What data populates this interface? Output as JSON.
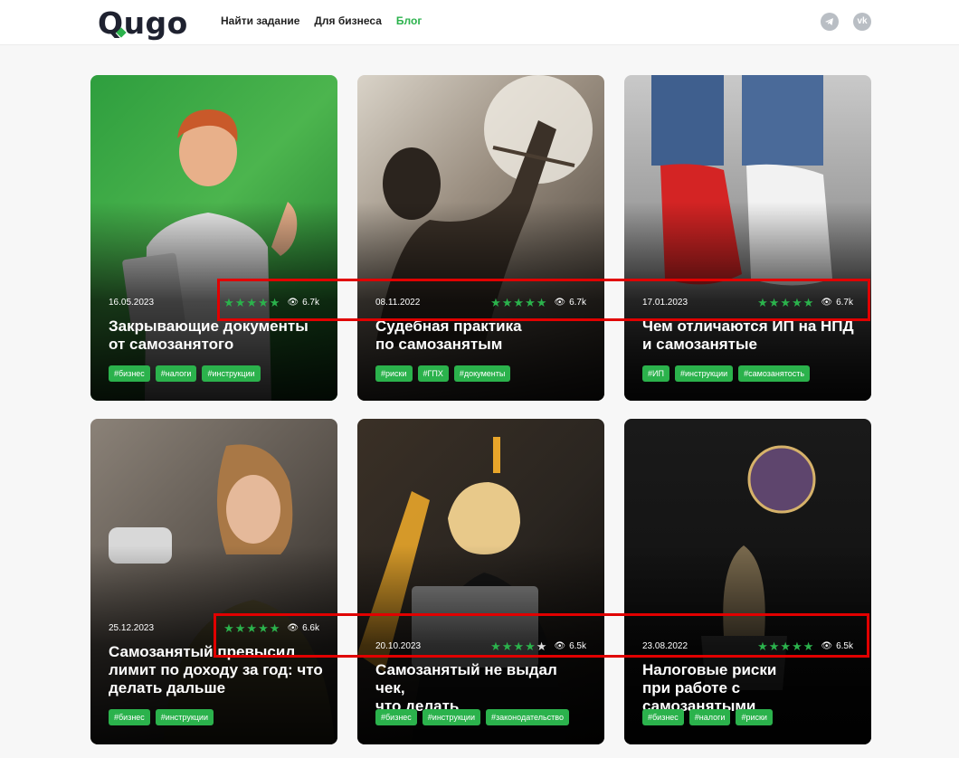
{
  "header": {
    "logo": "Qugo",
    "nav": [
      {
        "label": "Найти задание"
      },
      {
        "label": "Для бизнеса"
      },
      {
        "label": "Блог"
      }
    ],
    "social": [
      "telegram-icon",
      "vk-icon"
    ]
  },
  "colors": {
    "accent": "#2bb24c",
    "highlight": "#e10000"
  },
  "cards": [
    {
      "date": "16.05.2023",
      "rating": 5,
      "views": "6.7k",
      "title_line1": "Закрывающие документы",
      "title_line2": "от самозанятого",
      "tags": [
        "#бизнес",
        "#налоги",
        "#инструкции"
      ]
    },
    {
      "date": "08.11.2022",
      "rating": 5,
      "views": "6.7k",
      "title_line1": "Судебная практика",
      "title_line2": "по самозанятым",
      "tags": [
        "#риски",
        "#ГПХ",
        "#документы"
      ]
    },
    {
      "date": "17.01.2023",
      "rating": 5,
      "views": "6.7k",
      "title_line1": "Чем отличаются ИП на НПД",
      "title_line2": "и самозанятые",
      "tags": [
        "#ИП",
        "#инструкции",
        "#самозанятость"
      ]
    },
    {
      "date": "25.12.2023",
      "rating": 5,
      "views": "6.6k",
      "title_line1": "Самозанятый превысил",
      "title_line2": "лимит по доходу за год: что",
      "title_line3": "делать дальше",
      "tags": [
        "#бизнес",
        "#инструкции"
      ]
    },
    {
      "date": "20.10.2023",
      "rating": 4,
      "views": "6.5k",
      "title_line1": "Самозанятый не выдал чек,",
      "title_line2": "что делать",
      "tags": [
        "#бизнес",
        "#инструкции",
        "#законодательство"
      ]
    },
    {
      "date": "23.08.2022",
      "rating": 5,
      "views": "6.5k",
      "title_line1": "Налоговые риски",
      "title_line2": "при работе с самозанятыми",
      "tags": [
        "#бизнес",
        "#налоги",
        "#риски"
      ]
    }
  ]
}
